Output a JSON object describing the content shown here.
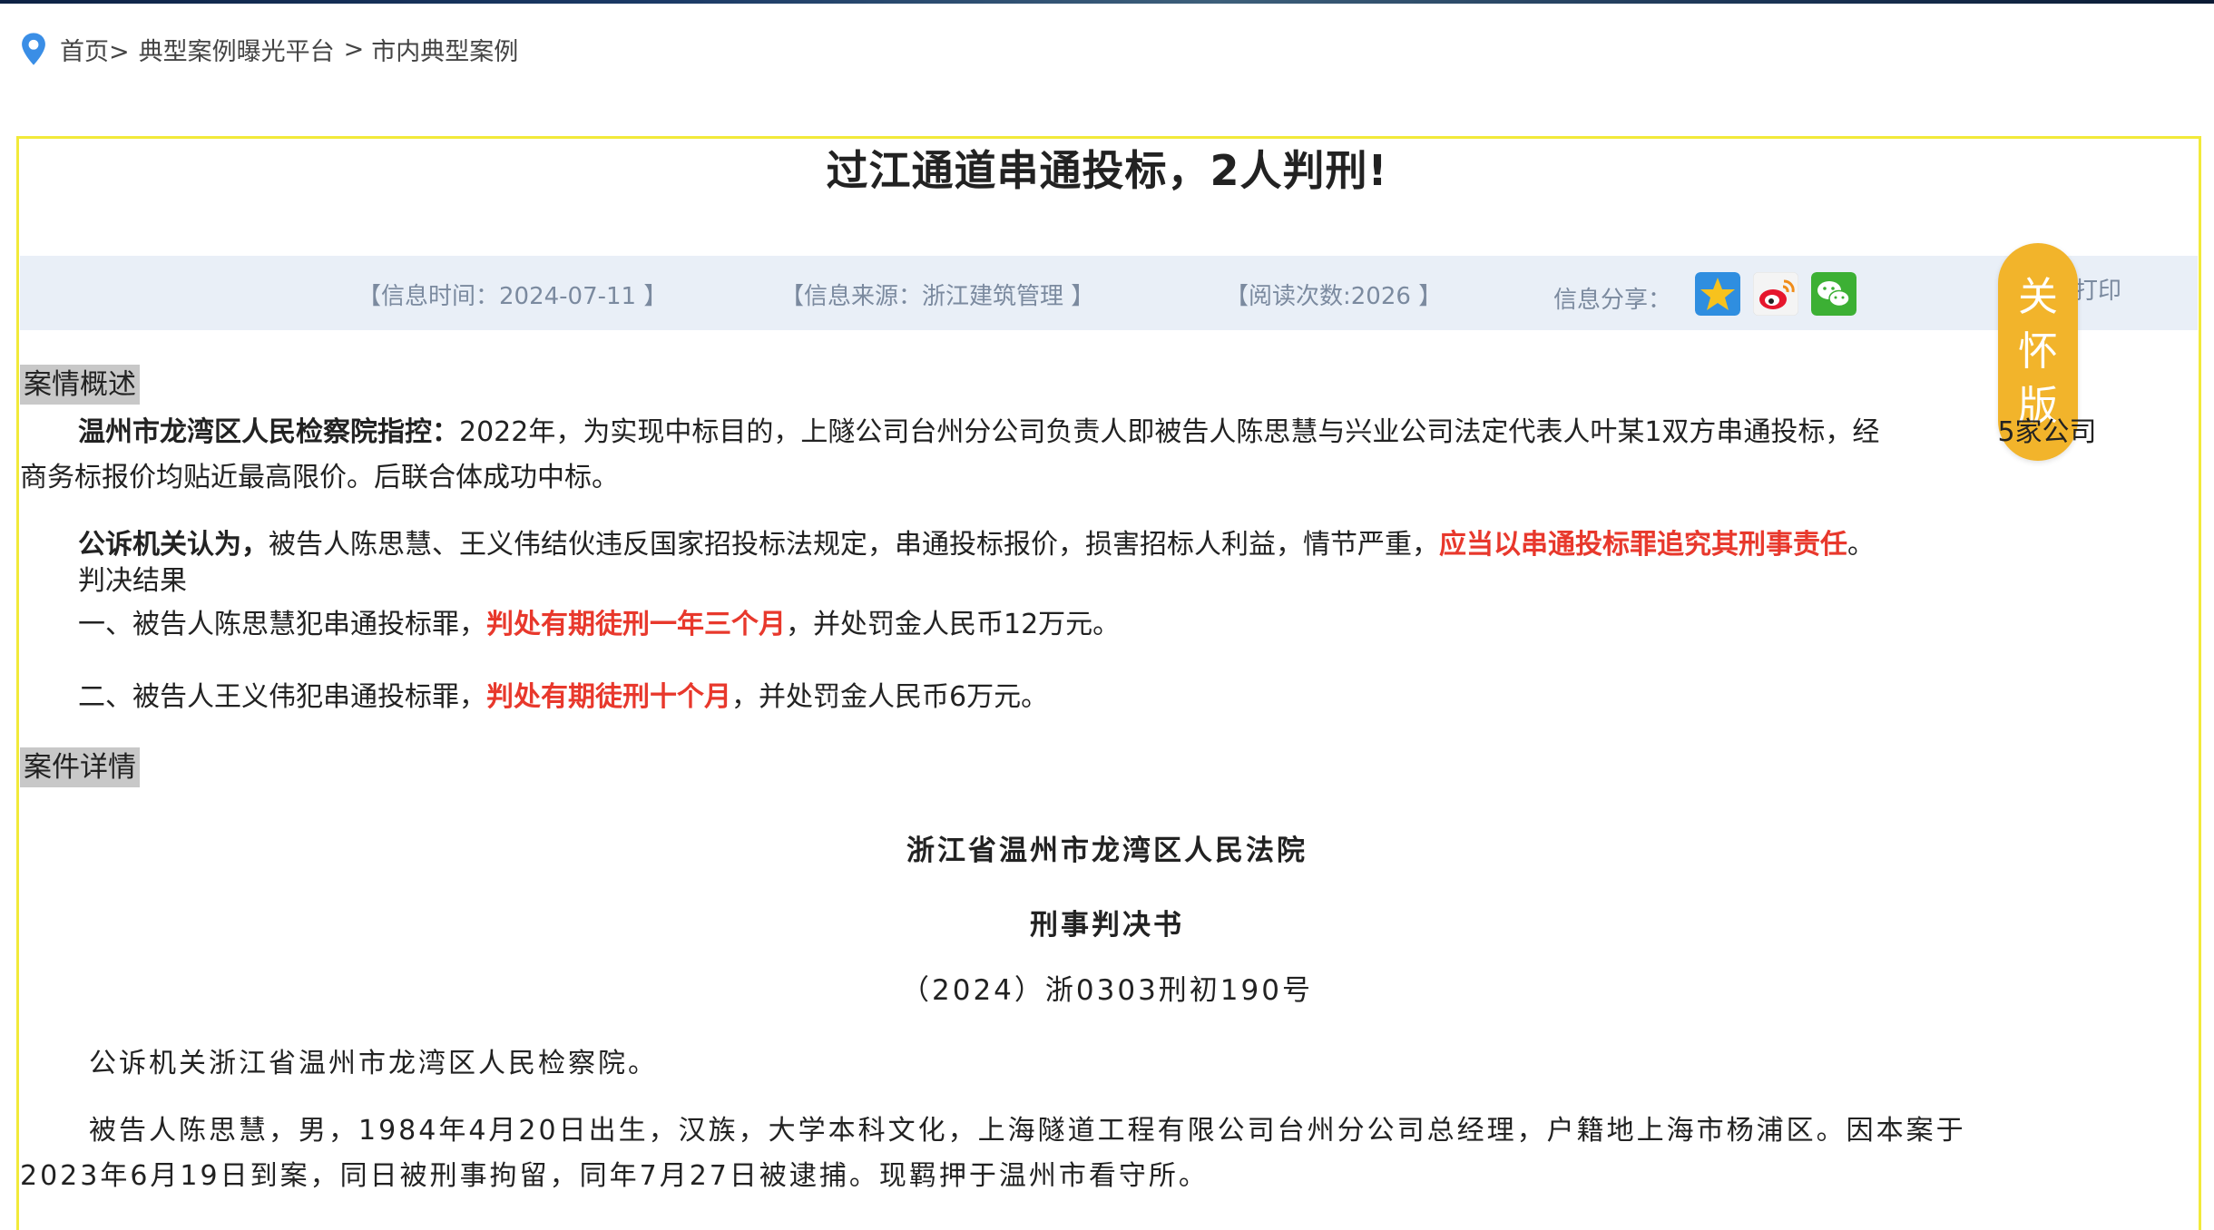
{
  "breadcrumb": {
    "items": [
      "首页>",
      "典型案例曝光平台",
      ">",
      "市内典型案例"
    ]
  },
  "article": {
    "title": "过江通道串通投标，2人判刑!",
    "info": {
      "time": "【信息时间：2024-07-11 】",
      "source": "【信息来源：浙江建筑管理 】",
      "reads": "【阅读次数:2026 】",
      "share_label": "信息分享：",
      "print_label": "打印"
    },
    "share_icons": [
      "qzone-icon",
      "weibo-icon",
      "wechat-icon"
    ],
    "care_mode": [
      "关",
      "怀",
      "版"
    ]
  },
  "overview": {
    "label": "案情概述",
    "p1_lead": "温州市龙湾区人民检察院指控：",
    "p1_text": "2022年，为实现中标目的，上隧公司台州分公司负责人即被告人陈思慧与兴业公司法定代表人叶某1双方串通投标，经",
    "p1_text_tail": "5家公司",
    "p1_line2": "商务标报价均贴近最高限价。后联合体成功中标。",
    "p2_lead": "公诉机关认为，",
    "p2_text": "被告人陈思慧、王义伟结伙违反国家招投标法规定，串通投标报价，损害招标人利益，情节严重，",
    "p2_red": "应当以串通投标罪追究其刑事责任",
    "p2_end": "。",
    "verdict_title": "判决结果",
    "v1_text": "一、被告人陈思慧犯串通投标罪，",
    "v1_red": "判处有期徒刑一年三个月",
    "v1_end": "，并处罚金人民币12万元。",
    "v2_text": "二、被告人王义伟犯串通投标罪，",
    "v2_red": "判处有期徒刑十个月",
    "v2_end": "，并处罚金人民币6万元。"
  },
  "details": {
    "label": "案件详情",
    "court": "浙江省温州市龙湾区人民法院",
    "doc_type": "刑事判决书",
    "case_no": "（2024）浙0303刑初190号",
    "prosecutor": "公诉机关浙江省温州市龙湾区人民检察院。",
    "defendant_line1": "被告人陈思慧，男，1984年4月20日出生，汉族，大学本科文化，上海隧道工程有限公司台州分公司总经理，户籍地上海市杨浦区。因本案于",
    "defendant_line2": "2023年6月19日到案，同日被刑事拘留，同年7月27日被逮捕。现羁押于温州市看守所。"
  },
  "colors": {
    "frame": "#f2ea3a",
    "infobar": "#e9eff7",
    "care_button": "#f2b42b",
    "highlight_red": "#e8382c",
    "pin": "#3a8ee6"
  }
}
